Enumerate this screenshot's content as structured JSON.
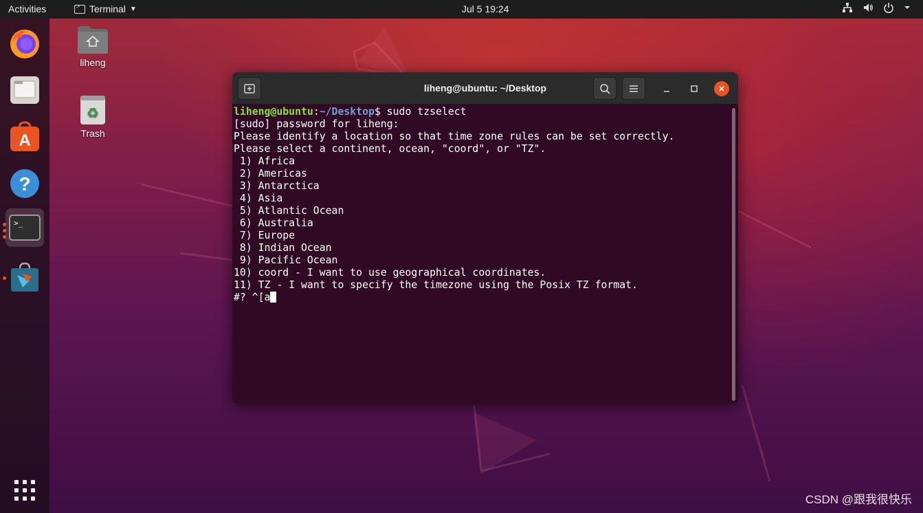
{
  "topbar": {
    "activities": "Activities",
    "app_name": "Terminal",
    "clock": "Jul 5  19:24"
  },
  "desktop": {
    "home_label": "liheng",
    "trash_label": "Trash"
  },
  "window": {
    "title": "liheng@ubuntu: ~/Desktop"
  },
  "terminal": {
    "prompt_user": "liheng@ubuntu",
    "prompt_colon": ":",
    "prompt_path": "~/Desktop",
    "prompt_suffix": "$ sudo tzselect",
    "lines": [
      "[sudo] password for liheng:",
      "Please identify a location so that time zone rules can be set correctly.",
      "Please select a continent, ocean, \"coord\", or \"TZ\".",
      " 1) Africa",
      " 2) Americas",
      " 3) Antarctica",
      " 4) Asia",
      " 5) Atlantic Ocean",
      " 6) Australia",
      " 7) Europe",
      " 8) Indian Ocean",
      " 9) Pacific Ocean",
      "10) coord - I want to use geographical coordinates.",
      "11) TZ - I want to specify the timezone using the Posix TZ format."
    ],
    "input_line": "#? ^[a"
  },
  "watermark": "CSDN @跟我很快乐",
  "colors": {
    "accent": "#e95420",
    "terminal_bg": "#300a24",
    "prompt_user": "#8ae234",
    "prompt_path": "#729fcf"
  }
}
